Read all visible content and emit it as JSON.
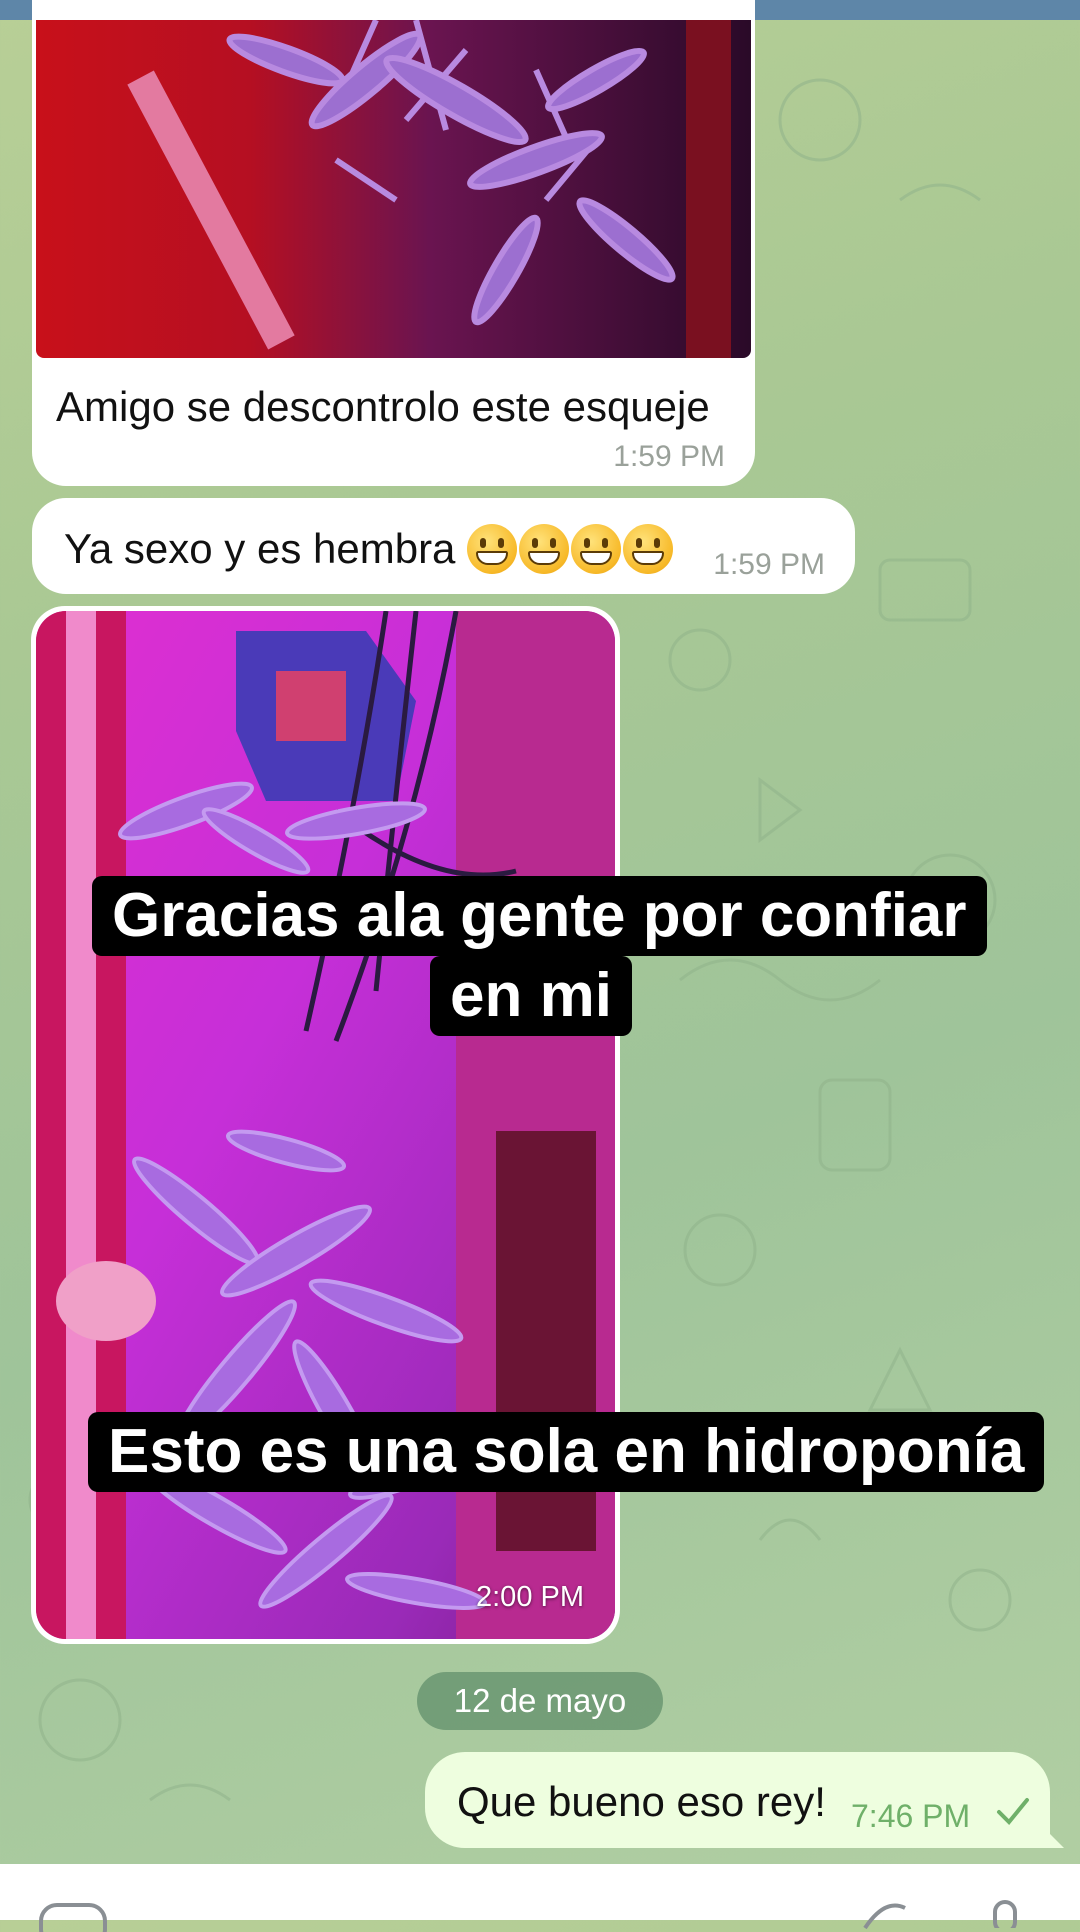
{
  "messages": [
    {
      "id": "m1",
      "direction": "incoming",
      "type": "photo",
      "caption": "Amigo se descontrolo este esqueje",
      "time": "1:59 PM"
    },
    {
      "id": "m2",
      "direction": "incoming",
      "type": "text",
      "text": "Ya sexo y es hembra",
      "emoji": "grinning-face x4",
      "time": "1:59 PM"
    },
    {
      "id": "m3",
      "direction": "incoming",
      "type": "photo",
      "overlay_captions": [
        "Gracias ala gente por confiar",
        "en mi",
        "Esto es una sola en hidroponía"
      ],
      "time": "2:00 PM"
    },
    {
      "id": "m4",
      "direction": "outgoing",
      "type": "text",
      "text": "Que bueno eso rey!",
      "time": "7:46 PM",
      "status": "sent-check-icon"
    }
  ],
  "date_separator": "12 de mayo",
  "colors": {
    "incoming_bubble": "#ffffff",
    "outgoing_bubble": "#eefedf",
    "outgoing_time": "#6fb069",
    "date_pill": "#5d8c68",
    "top_bar": "#5e86a8"
  },
  "input_bar": {
    "icons": [
      "emoji-icon",
      "attach-icon",
      "mic-icon"
    ]
  }
}
